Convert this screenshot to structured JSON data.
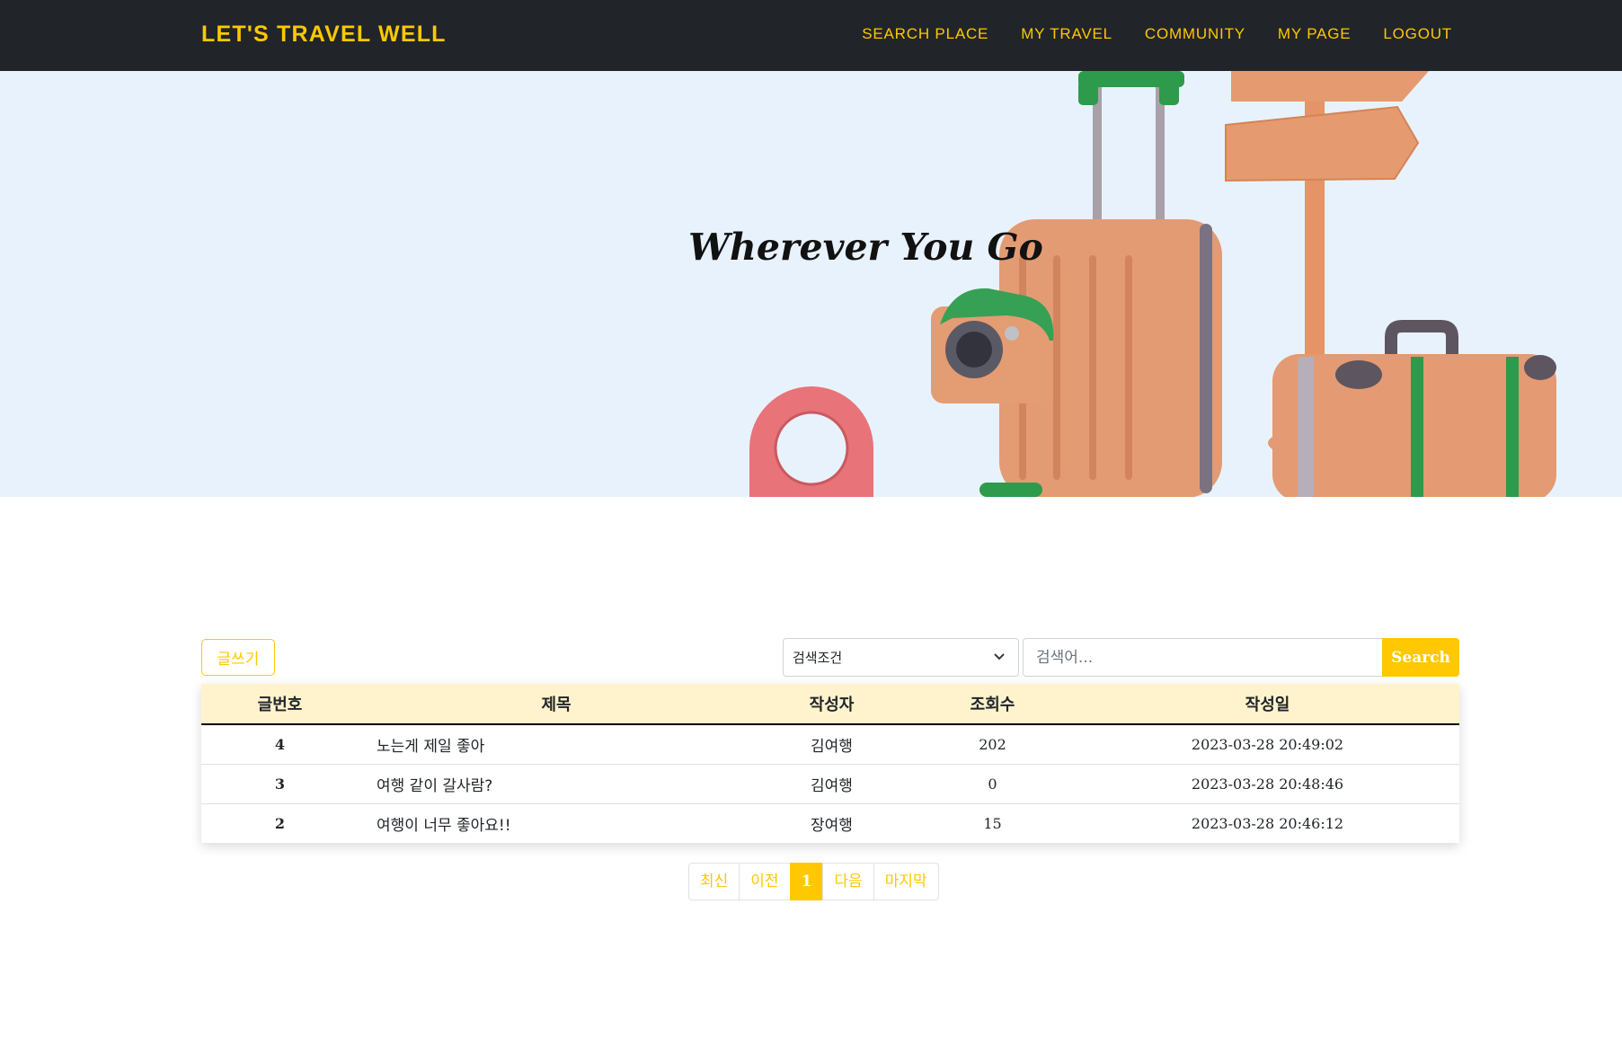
{
  "navbar": {
    "brand": "LET'S TRAVEL WELL",
    "links": [
      {
        "label": "SEARCH PLACE"
      },
      {
        "label": "MY TRAVEL"
      },
      {
        "label": "COMMUNITY"
      },
      {
        "label": "MY PAGE"
      },
      {
        "label": "LOGOUT"
      }
    ]
  },
  "hero": {
    "title": "Wherever You Go",
    "illustration_icons": [
      "location-pin-icon",
      "camera-icon",
      "suitcase-icon",
      "signpost-icon",
      "travel-case-icon"
    ]
  },
  "board": {
    "write_label": "글쓰기",
    "search": {
      "condition_selected": "검색조건",
      "keyword_placeholder": "검색어...",
      "button_label": "Search"
    },
    "columns": [
      "글번호",
      "제목",
      "작성자",
      "조회수",
      "작성일"
    ],
    "rows": [
      {
        "no": "4",
        "title": "노는게 제일 좋아",
        "author": "김여행",
        "views": "202",
        "date": "2023-03-28 20:49:02"
      },
      {
        "no": "3",
        "title": "여행 같이 갈사람?",
        "author": "김여행",
        "views": "0",
        "date": "2023-03-28 20:48:46"
      },
      {
        "no": "2",
        "title": "여행이 너무 좋아요!!",
        "author": "장여행",
        "views": "15",
        "date": "2023-03-28 20:46:12"
      }
    ]
  },
  "pagination": {
    "first": "최신",
    "prev": "이전",
    "current": "1",
    "next": "다음",
    "last": "마지막"
  },
  "colors": {
    "accent": "#ffc800",
    "navbar_bg": "#212529",
    "hero_bg": "#e8f2fd",
    "table_header_bg": "#fff3cd"
  }
}
